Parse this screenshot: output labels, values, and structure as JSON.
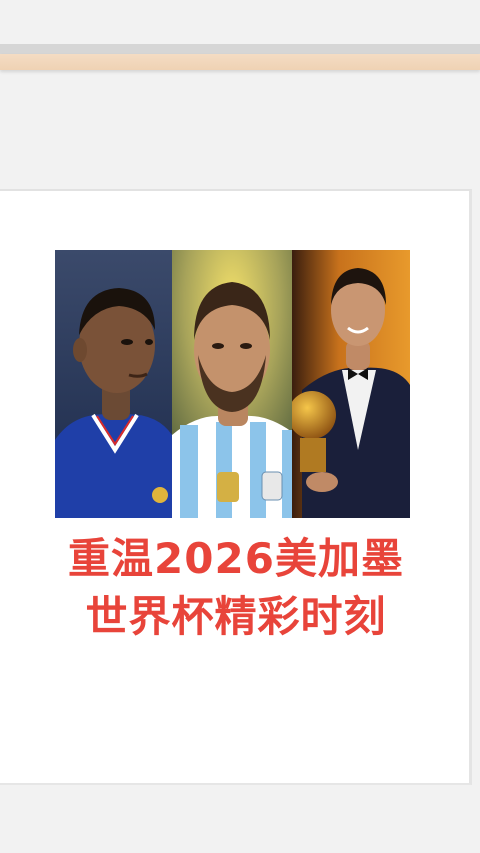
{
  "headline": {
    "line1": "重温2026美加墨",
    "line2": "世界杯精彩时刻"
  },
  "colors": {
    "headline": "#e8443a",
    "background": "#f2f2f2",
    "card": "#ffffff",
    "wood_strip": "#f0d6b9"
  },
  "photos": [
    {
      "name": "player-france-jersey"
    },
    {
      "name": "player-argentina-jersey"
    },
    {
      "name": "player-tuxedo-golden-ball"
    }
  ]
}
